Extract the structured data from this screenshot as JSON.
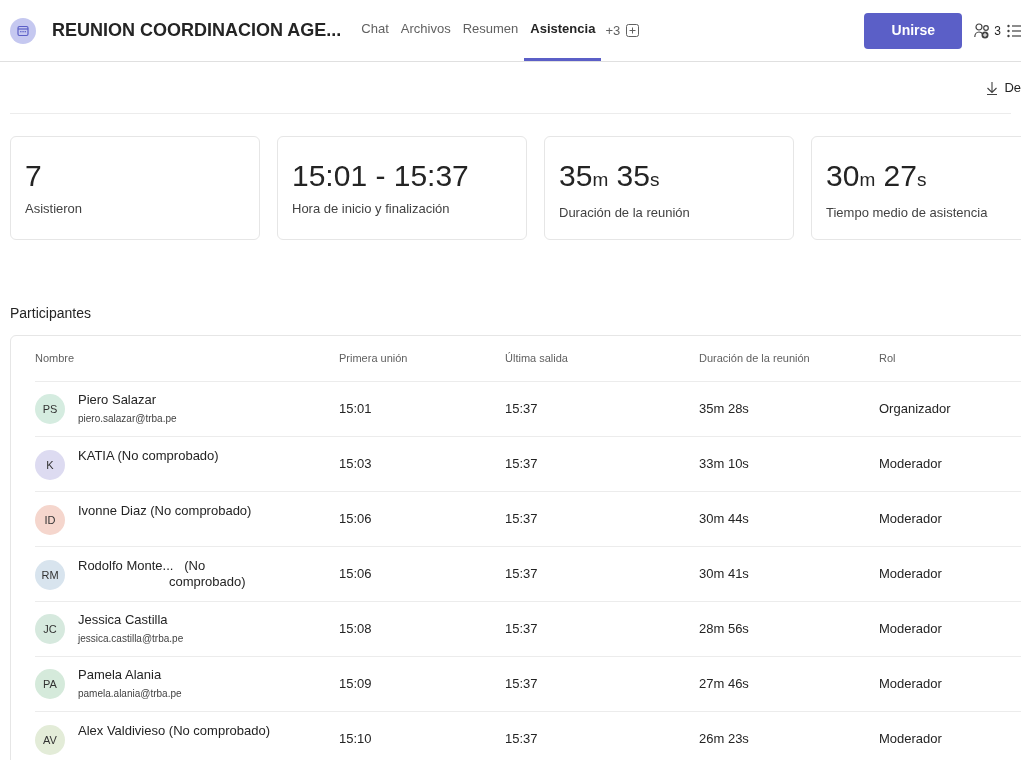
{
  "header": {
    "title": "REUNION COORDINACION AGE...",
    "tabs": [
      {
        "label": "Chat",
        "selected": false
      },
      {
        "label": "Archivos",
        "selected": false
      },
      {
        "label": "Resumen",
        "selected": false
      },
      {
        "label": "Asistencia",
        "selected": true
      }
    ],
    "more_tabs": "+3",
    "join_button": "Unirse",
    "participants_count": "3"
  },
  "toolbar": {
    "download": "De"
  },
  "stats": [
    {
      "value_parts": [
        {
          "text": "7",
          "kind": "number"
        }
      ],
      "label": "Asistieron"
    },
    {
      "value_parts": [
        {
          "text": "15:01 - 15:37",
          "kind": "number"
        }
      ],
      "label": "Hora de inicio y finalización"
    },
    {
      "value_parts": [
        {
          "text": "35",
          "kind": "number"
        },
        {
          "text": "m",
          "kind": "unit"
        },
        {
          "text": " 35",
          "kind": "number"
        },
        {
          "text": "s",
          "kind": "unit"
        }
      ],
      "label": "Duración de la reunión"
    },
    {
      "value_parts": [
        {
          "text": "30",
          "kind": "number"
        },
        {
          "text": "m",
          "kind": "unit"
        },
        {
          "text": " 27",
          "kind": "number"
        },
        {
          "text": "s",
          "kind": "unit"
        }
      ],
      "label": "Tiempo medio de asistencia"
    }
  ],
  "participants": {
    "title": "Participantes",
    "columns": [
      "Nombre",
      "Primera unión",
      "Última salida",
      "Duración de la reunión",
      "Rol"
    ],
    "rows": [
      {
        "initials": "PS",
        "color": "#d5ece0",
        "name_lines": [
          "Piero Salazar"
        ],
        "email": "piero.salazar@trba.pe",
        "first_join": "15:01",
        "last_leave": "15:37",
        "duration": "35m 28s",
        "role": "Organizador"
      },
      {
        "initials": "K",
        "color": "#dddbf1",
        "name_lines": [
          "KATIA (No comprobado)"
        ],
        "first_join": "15:03",
        "last_leave": "15:37",
        "duration": "33m 10s",
        "role": "Moderador"
      },
      {
        "initials": "ID",
        "color": "#f5d6cd",
        "name_lines": [
          "Ivonne Diaz (No comprobado)"
        ],
        "first_join": "15:06",
        "last_leave": "15:37",
        "duration": "30m 44s",
        "role": "Moderador"
      },
      {
        "initials": "RM",
        "color": "#d8e4ee",
        "name_lines": [
          "Rodolfo Monte...   (No",
          "comprobado)"
        ],
        "first_join": "15:06",
        "last_leave": "15:37",
        "duration": "30m 41s",
        "role": "Moderador"
      },
      {
        "initials": "JC",
        "color": "#d6e9de",
        "name_lines": [
          "Jessica Castilla"
        ],
        "email": "jessica.castilla@trba.pe",
        "first_join": "15:08",
        "last_leave": "15:37",
        "duration": "28m 56s",
        "role": "Moderador"
      },
      {
        "initials": "PA",
        "color": "#d5eadb",
        "name_lines": [
          "Pamela Alania"
        ],
        "email": "pamela.alania@trba.pe",
        "first_join": "15:09",
        "last_leave": "15:37",
        "duration": "27m 46s",
        "role": "Moderador"
      },
      {
        "initials": "AV",
        "color": "#e3ecd8",
        "name_lines": [
          "Alex Valdivieso (No comprobado)"
        ],
        "first_join": "15:10",
        "last_leave": "15:37",
        "duration": "26m 23s",
        "role": "Moderador"
      }
    ]
  }
}
